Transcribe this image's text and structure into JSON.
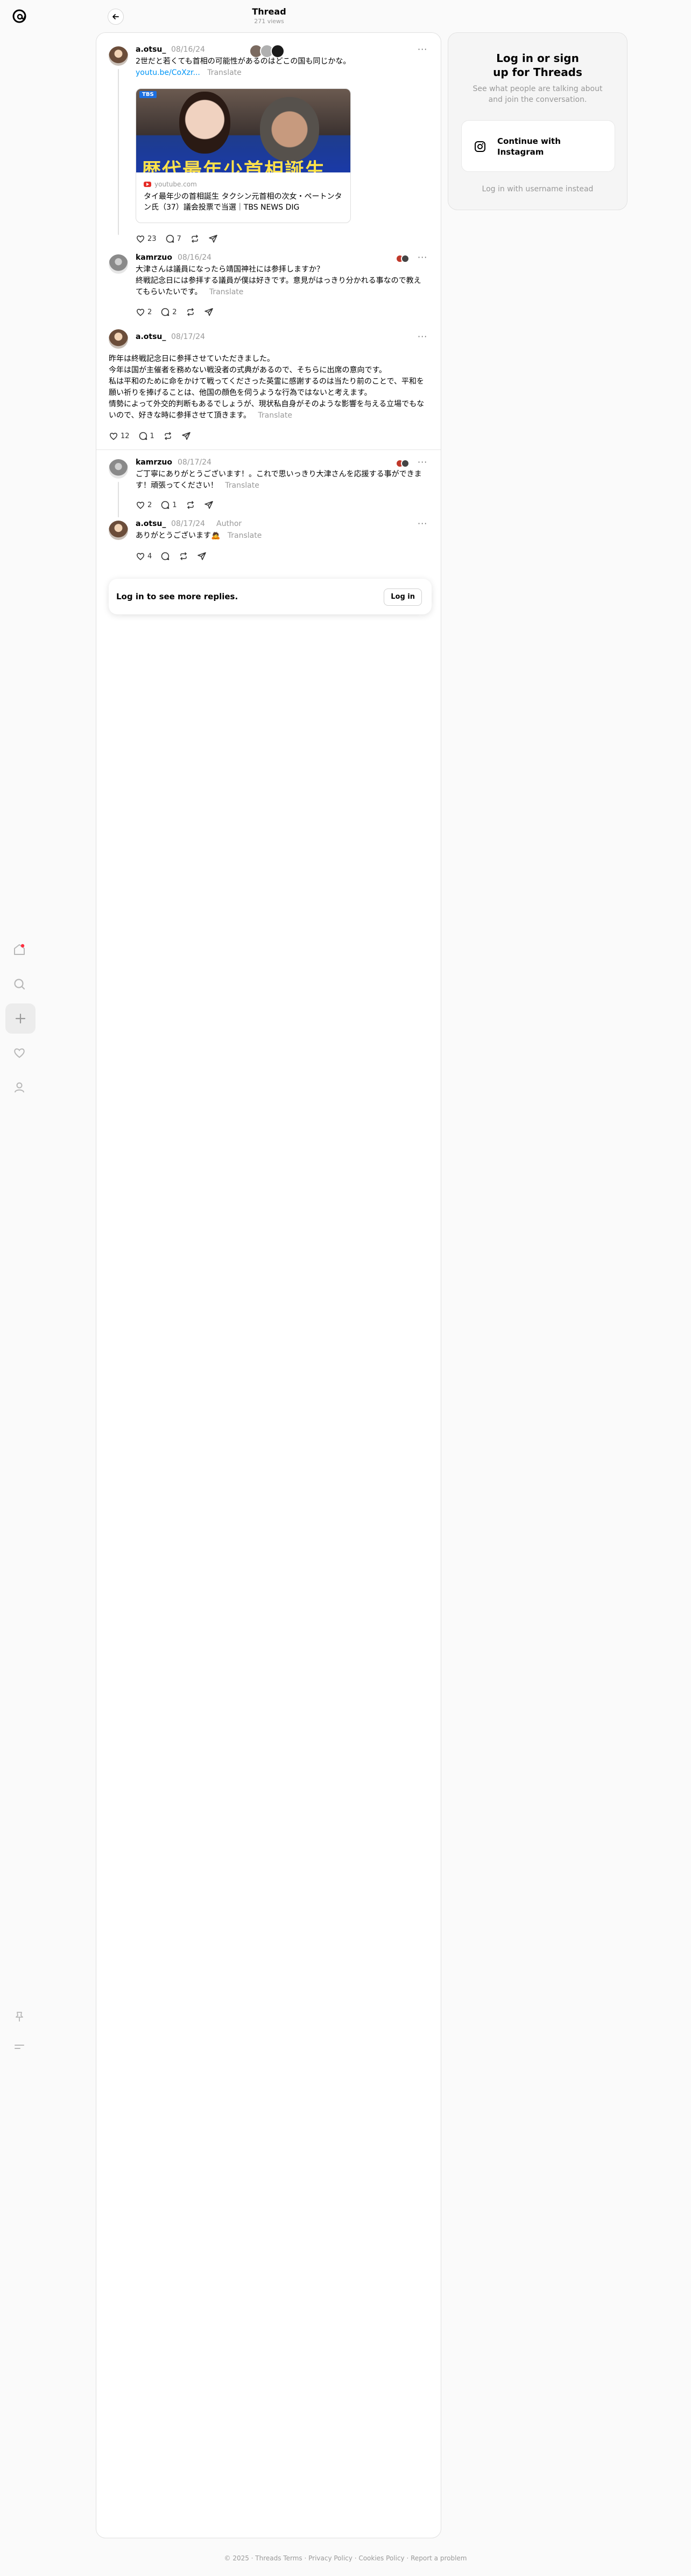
{
  "header": {
    "title": "Thread",
    "subtitle": "271 views"
  },
  "nav": {
    "items": [
      {
        "icon": "home-icon"
      },
      {
        "icon": "search-icon"
      },
      {
        "icon": "create-icon"
      },
      {
        "icon": "activity-heart-icon"
      },
      {
        "icon": "profile-icon"
      }
    ],
    "bottom": [
      {
        "icon": "pin-icon"
      },
      {
        "icon": "menu-icon"
      }
    ],
    "notification_color": "#ff3040"
  },
  "root_post": {
    "username": "a.otsu_",
    "date": "08/16/24",
    "text": "2世だと若くても首相の可能性があるのはどこの国も同じかな。",
    "link_text": "youtu.be/CoXzr...",
    "translate": "Translate",
    "card": {
      "domain": "youtube.com",
      "image_caption": "歴代最年少首相誕生",
      "badge": "TBS",
      "title": "タイ最年少の首相誕生 タクシン元首相の次女・ペートンタン氏（37）議会投票で当選｜TBS NEWS DIG"
    },
    "likes": "23",
    "replies": "7"
  },
  "replies": [
    {
      "username": "kamrzuo",
      "date": "08/16/24",
      "text": "大津さんは議員になったら靖国神社には参拝しますか？\n終戦記念日には参拝する議員が僕は好きです。意見がはっきり分かれる事なので教えてもらいたいです。",
      "translate": "Translate",
      "likes": "2",
      "replies": "2"
    },
    {
      "username": "a.otsu_",
      "date": "08/17/24",
      "text": "昨年は終戦記念日に参拝させていただきました。\n今年は国が主催者を務めない戦没者の式典があるので、そちらに出席の意向です。\n私は平和のために命をかけて戦ってくださった英霊に感謝するのは当たり前のことで、平和を願い祈りを捧げることは、他国の顔色を伺うような行為ではないと考えます。\n情勢によって外交的判断もあるでしょうが、現状私自身がそのような影響を与える立場でもないので、好きな時に参拝させて頂きます。",
      "translate": "Translate",
      "likes": "12",
      "replies": "1"
    },
    {
      "username": "kamrzuo",
      "date": "08/17/24",
      "text": "ご丁寧にありがとうございます！。これで思いっきり大津さんを応援する事ができます！頑張ってください！",
      "translate": "Translate",
      "likes": "2",
      "replies": "1"
    },
    {
      "username": "a.otsu_",
      "date": "08/17/24",
      "author_tag": "Author",
      "text": "ありがとうございます🙇",
      "translate": "Translate",
      "likes": "4",
      "replies": ""
    }
  ],
  "login_prompt": {
    "text": "Log in to see more replies.",
    "button": "Log in"
  },
  "side": {
    "title": "Log in or sign up for Threads",
    "description": "See what people are talking about and join the conversation.",
    "ig_button": "Continue with Instagram",
    "alt_login": "Log in with username instead"
  },
  "footer": "© 2025 · Threads Terms · Privacy Policy · Cookies Policy · Report a problem"
}
